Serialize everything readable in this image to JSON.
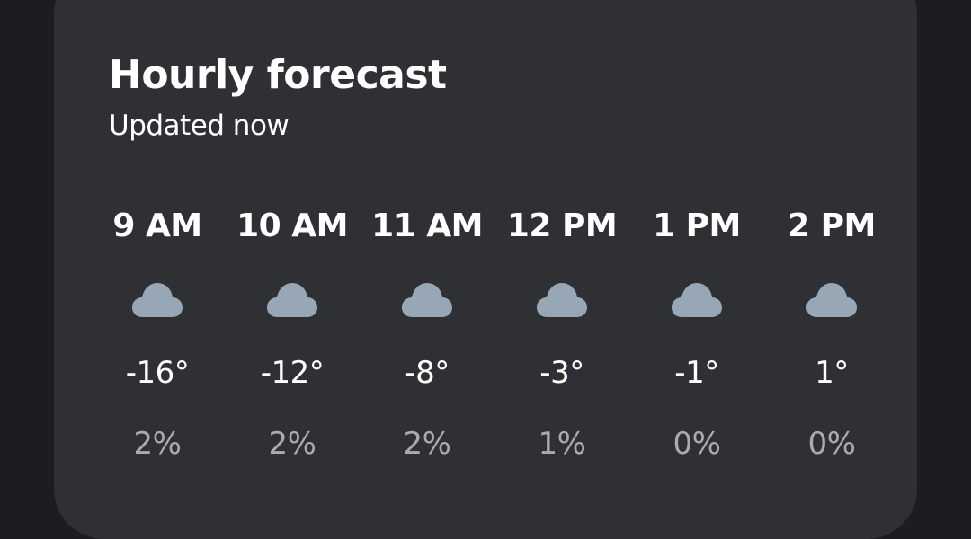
{
  "forecast": {
    "title": "Hourly forecast",
    "subtitle": "Updated now"
  },
  "colors": {
    "background": "#1b1d20",
    "card": "#2e3033",
    "text": "#ffffff",
    "muted_text": "#a9abae",
    "cloud_icon": "#98a7b6"
  },
  "hours": [
    {
      "time": "9 AM",
      "icon": "cloud-icon",
      "temp": "-16°",
      "precip": "2%"
    },
    {
      "time": "10 AM",
      "icon": "cloud-icon",
      "temp": "-12°",
      "precip": "2%"
    },
    {
      "time": "11 AM",
      "icon": "cloud-icon",
      "temp": "-8°",
      "precip": "2%"
    },
    {
      "time": "12 PM",
      "icon": "cloud-icon",
      "temp": "-3°",
      "precip": "1%"
    },
    {
      "time": "1 PM",
      "icon": "cloud-icon",
      "temp": "-1°",
      "precip": "0%"
    },
    {
      "time": "2 PM",
      "icon": "cloud-icon",
      "temp": "1°",
      "precip": "0%"
    }
  ]
}
